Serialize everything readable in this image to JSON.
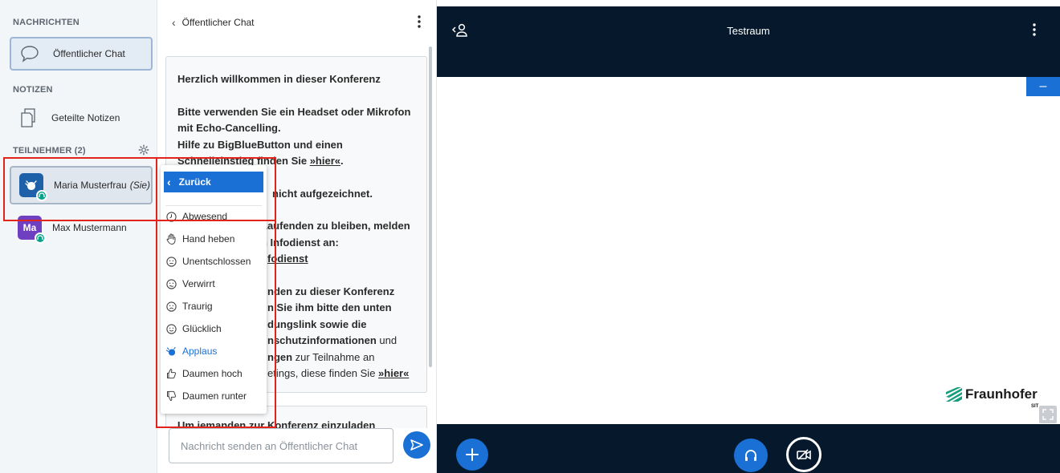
{
  "sidebar": {
    "messages_heading": "NACHRICHTEN",
    "public_chat_label": "Öffentlicher Chat",
    "notes_heading": "NOTIZEN",
    "shared_notes_label": "Geteilte Notizen",
    "participants_heading": "TEILNEHMER (2)",
    "users": [
      {
        "initials": "",
        "name": "Maria Musterfrau",
        "suffix": "(Sie)",
        "avatar_color": "#1e61a8"
      },
      {
        "initials": "Ma",
        "name": "Max Mustermann",
        "suffix": "",
        "avatar_color": "#6f3fc1"
      }
    ]
  },
  "chat": {
    "title": "Öffentlicher Chat",
    "welcome": {
      "line1": "Herzlich willkommen in dieser Konferenz",
      "line2": "Bitte verwenden Sie ein Headset oder Mikrofon",
      "line3": "mit Echo-Cancelling.",
      "line4": "Hilfe zu BigBlueButton und einen",
      "line5_pre": "Schnelleinstieg finden Sie ",
      "line5_link": "»hier«",
      "line5_post": ".",
      "line6": "nicht aufgezeichnet.",
      "line7": "Laufenden zu bleiben, melden",
      "line8": "n Infodienst an:",
      "line9_link": "fodienst",
      "line10": "nden zu dieser Konferenz",
      "line11": "n Sie ihm bitte den unten",
      "line12": "dungslink sowie die",
      "line13_bold": "nschutzinformationen",
      "line13_post": " und",
      "line14_bold": "ngen",
      "line14_post": " zur Teilnahme an",
      "line15_pre": "etings, diese finden Sie ",
      "line15_link": "»hier«"
    },
    "second_message": "Um jemanden zur Konferenz einzuladen",
    "input_placeholder": "Nachricht senden an Öffentlicher Chat"
  },
  "status_menu": {
    "back_label": "Zurück",
    "items": [
      {
        "label": "Abwesend",
        "icon": "clock-icon"
      },
      {
        "label": "Hand heben",
        "icon": "raise-hand-icon"
      },
      {
        "label": "Unentschlossen",
        "icon": "neutral-face-icon"
      },
      {
        "label": "Verwirrt",
        "icon": "confused-face-icon"
      },
      {
        "label": "Traurig",
        "icon": "sad-face-icon"
      },
      {
        "label": "Glücklich",
        "icon": "happy-face-icon"
      },
      {
        "label": "Applaus",
        "icon": "applause-icon",
        "selected": true
      },
      {
        "label": "Daumen hoch",
        "icon": "thumbs-up-icon"
      },
      {
        "label": "Daumen runter",
        "icon": "thumbs-down-icon"
      }
    ]
  },
  "main": {
    "room_title": "Testraum",
    "minimize_label": "–",
    "logo_text": "Fraunhofer",
    "logo_sub": "SIT"
  },
  "colors": {
    "accent": "#1b70d5",
    "dark_bar": "#05182c",
    "annotation": "#e2231a",
    "audio_badge": "#00a28a"
  }
}
